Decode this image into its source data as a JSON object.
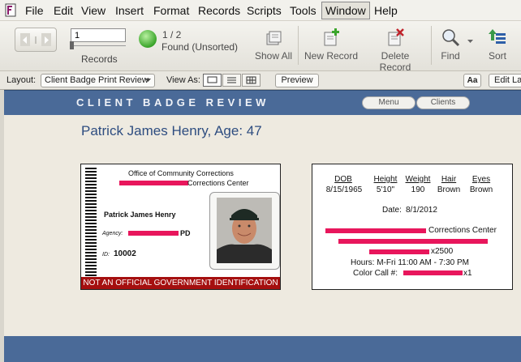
{
  "menu": [
    "File",
    "Edit",
    "View",
    "Insert",
    "Format",
    "Records",
    "Scripts",
    "Tools",
    "Window",
    "Help"
  ],
  "toolbar": {
    "record_number": "1",
    "records_label": "Records",
    "count": "1 / 2",
    "found_status": "Found (Unsorted)",
    "buttons": {
      "show_all": "Show All",
      "new_record": "New Record",
      "delete_record": "Delete Record",
      "find": "Find",
      "sort": "Sort"
    }
  },
  "layoutbar": {
    "layout_label": "Layout:",
    "layout_value": "Client Badge Print Review",
    "view_as_label": "View As:",
    "preview": "Preview",
    "aa": "Aa",
    "edit_layout": "Edit La"
  },
  "header": {
    "title": "CLIENT BADGE REVIEW",
    "menu_button": "Menu",
    "clients_button": "Clients"
  },
  "record_title": "Patrick James Henry, Age: 47",
  "badge": {
    "office": "Office of Community Corrections",
    "center_suffix": "Corrections Center",
    "name": "Patrick James Henry",
    "agency_label": "Agency:",
    "agency_suffix": "PD",
    "id_label": "ID:",
    "id_value": "10002",
    "disclaimer": "NOT AN OFFICIAL GOVERNMENT IDENTIFICATION"
  },
  "info": {
    "headers": [
      "DOB",
      "Height",
      "Weight",
      "Hair",
      "Eyes"
    ],
    "values": [
      "8/15/1965",
      "5'10\"",
      "190",
      "Brown",
      "Brown"
    ],
    "date_label": "Date:",
    "date_value": "8/1/2012",
    "center_suffix": "Corrections Center",
    "ext": "x2500",
    "hours": "Hours: M-Fri 11:00 AM - 7:30 PM",
    "color_call_label": "Color Call #:",
    "color_call_ext": "x1"
  },
  "colors": {
    "header_band": "#4a6a98",
    "title_blue": "#2e4d80",
    "disclaimer_red": "#a50f0f",
    "redaction": "#e8165c"
  }
}
